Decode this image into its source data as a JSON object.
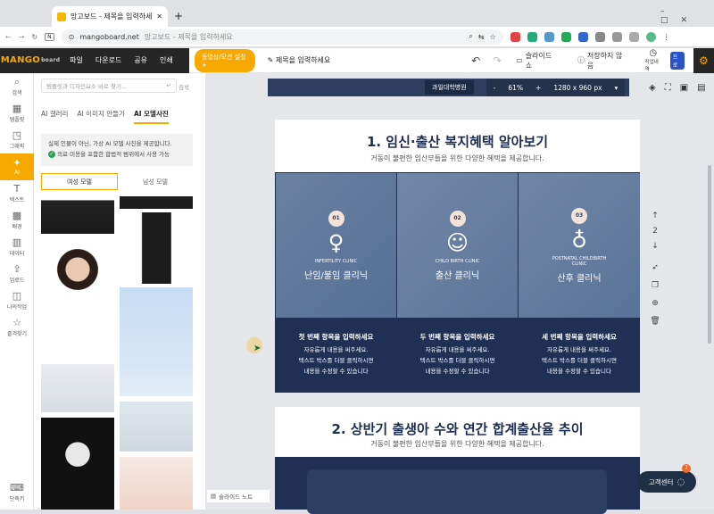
{
  "browser": {
    "tab_title": "망고보드 - 제목을 입력하세요",
    "url_domain": "mangoboard.net",
    "url_rest": "망고보드 - 제목을 입력하세요"
  },
  "app": {
    "logo": "MANGO",
    "logo_small": "board",
    "menu": [
      "파일",
      "다운로드",
      "공유",
      "인쇄"
    ],
    "motion_btn": "동영상/모션 설정 +",
    "title_placeholder": "제목을 입력하세요",
    "slideshow": "슬라이드 쇼",
    "save_status": "저장하지 않음",
    "history": "작업내역",
    "pro": "프로"
  },
  "leftnav": [
    {
      "icon": "⌕",
      "label": "검색"
    },
    {
      "icon": "▦",
      "label": "템플릿"
    },
    {
      "icon": "◳",
      "label": "그래픽"
    },
    {
      "icon": "✦",
      "label": "AI"
    },
    {
      "icon": "T",
      "label": "텍스트"
    },
    {
      "icon": "▩",
      "label": "배경"
    },
    {
      "icon": "▥",
      "label": "데이터"
    },
    {
      "icon": "⇪",
      "label": "업로드"
    },
    {
      "icon": "◫",
      "label": "나의작업"
    },
    {
      "icon": "☆",
      "label": "즐겨찾기"
    }
  ],
  "shortcut": "단축키",
  "panel": {
    "search_placeholder": "템플릿과 디자인요소 바로 찾기...",
    "search_btn": "검색",
    "subtabs": [
      "AI 갤러리",
      "AI 이미지 만들기",
      "AI 모델사진"
    ],
    "notice1": "실제 인물이 아닌, 가상 AI 모델 사진을 제공합니다.",
    "notice2": "의료·미용을 포함한 합법적 범위에서 사용 가능",
    "female": "여성 모델",
    "male": "남성 모델"
  },
  "zoom": {
    "badge": "과일대학병원",
    "minus": "-",
    "pct": "61%",
    "plus": "+",
    "size": "1280 x 960 px"
  },
  "section1": {
    "title": "1. 임신·출산 복지혜택 알아보기",
    "subtitle": "거동이 불편한 임산부들을 위한 다양한 혜택을 제공합니다.",
    "cards": [
      {
        "num": "01",
        "en": "INFERTILITY CLINIC",
        "ko": "난임/불임 클리닉",
        "head": "첫 번째 항목을 입력하세요",
        "l1": "자유롭게 내용을 써주세요.",
        "l2": "텍스트 박스를 더블 클릭하시면",
        "l3": "내용을 수정할 수 있습니다",
        "tone": "#6f86a6"
      },
      {
        "num": "02",
        "en": "CHILD BIRTH CLINIC",
        "ko": "출산 클리닉",
        "head": "두 번째 항목을 입력하세요",
        "l1": "자유롭게 내용을 써주세요.",
        "l2": "텍스트 박스를 더블 클릭하시면",
        "l3": "내용을 수정할 수 있습니다",
        "tone": "#8aa0bd"
      },
      {
        "num": "03",
        "en": "POSTNATAL CHILDBIRTH CLINIC",
        "ko": "산후 클리닉",
        "head": "세 번째 항목을 입력하세요",
        "l1": "자유롭게 내용을 써주세요.",
        "l2": "텍스트 박스를 더블 클릭하시면",
        "l3": "내용을 수정할 수 있습니다",
        "tone": "#7d95b5"
      }
    ]
  },
  "section2": {
    "title": "2. 상반기 출생아 수와 연간 합계출산율 추이",
    "subtitle": "거동이 불편한 임산부들을 위한 다양한 혜택을 제공합니다."
  },
  "pager": {
    "up": "↑",
    "page": "2",
    "down": "↓"
  },
  "help": {
    "label": "고객센터",
    "count": "7"
  },
  "slide_note": "슬라이드 노트"
}
